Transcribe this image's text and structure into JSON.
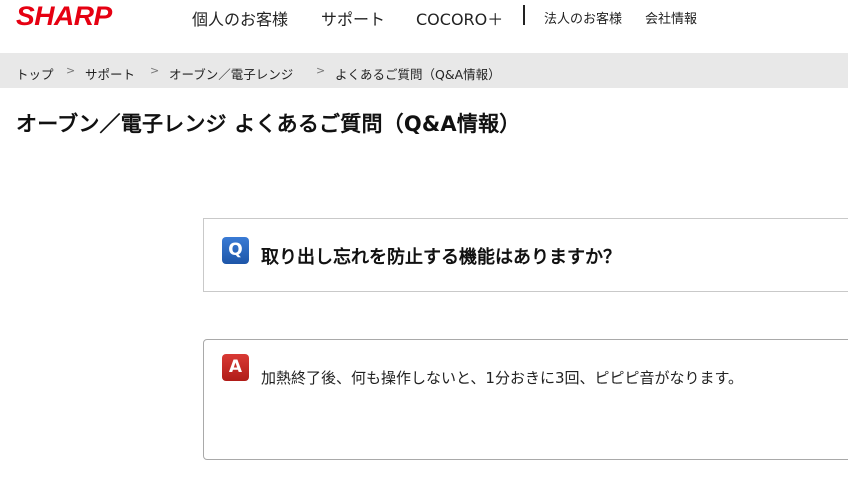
{
  "header": {
    "logo": "SHARP",
    "nav_main": [
      "個人のお客様",
      "サポート",
      "COCORO＋"
    ],
    "nav_sub": [
      "法人のお客様",
      "会社情報"
    ]
  },
  "breadcrumb": [
    "トップ",
    "サポート",
    "オーブン／電子レンジ",
    "よくあるご質問（Q&A情報）"
  ],
  "breadcrumb_separator": ">",
  "page_title": "オーブン／電子レンジ よくあるご質問（Q&A情報）",
  "qa": {
    "question_badge": "Q",
    "question": "取り出し忘れを防止する機能はありますか？",
    "answer_badge": "A",
    "answer": "加熱終了後、何も操作しないと、1分おきに3回、ピピピ音がなります。"
  },
  "colors": {
    "brand": "#e60012",
    "question_badge": "#2a67c2",
    "answer_badge": "#c8221e",
    "breadcrumb_bg": "#e8e8e8"
  }
}
